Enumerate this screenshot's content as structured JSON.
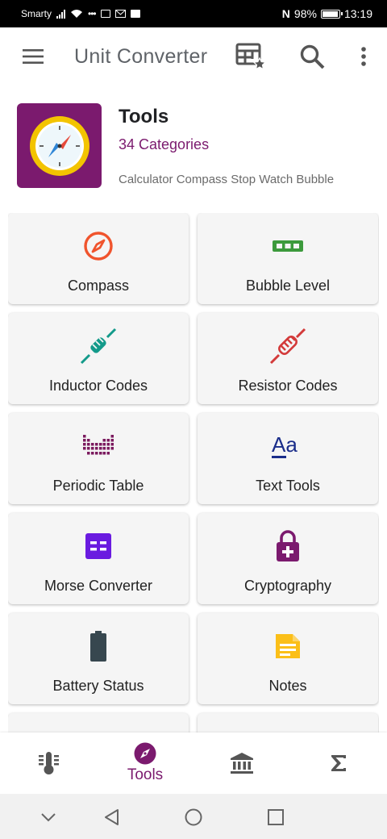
{
  "status_bar": {
    "carrier": "Smarty",
    "battery": "98%",
    "time": "13:19"
  },
  "app_bar": {
    "title": "Unit Converter",
    "icons": [
      "menu-icon",
      "table-favorite-icon",
      "search-icon",
      "more-vert-icon"
    ]
  },
  "header": {
    "title": "Tools",
    "subtitle": "34 Categories",
    "description": "Calculator Compass Stop Watch Bubble",
    "icon": "compass-icon"
  },
  "tools": [
    {
      "label": "Compass",
      "icon": "compass-icon",
      "color": "#f0542d"
    },
    {
      "label": "Bubble Level",
      "icon": "bubble-level-icon",
      "color": "#3c9a3c"
    },
    {
      "label": "Inductor Codes",
      "icon": "inductor-icon",
      "color": "#139a8a"
    },
    {
      "label": "Resistor Codes",
      "icon": "resistor-icon",
      "color": "#d33a3a"
    },
    {
      "label": "Periodic Table",
      "icon": "periodic-table-icon",
      "color": "#7b1a5e"
    },
    {
      "label": "Text Tools",
      "icon": "text-format-icon",
      "color": "#1a2d8a"
    },
    {
      "label": "Morse Converter",
      "icon": "morse-icon",
      "color": "#6a1be0"
    },
    {
      "label": "Cryptography",
      "icon": "lock-icon",
      "color": "#7b1a6e"
    },
    {
      "label": "Battery Status",
      "icon": "battery-icon",
      "color": "#37474f"
    },
    {
      "label": "Notes",
      "icon": "note-icon",
      "color": "#fbbf18"
    }
  ],
  "bottom_nav": {
    "items": [
      {
        "icon": "thermometer-icon",
        "label": ""
      },
      {
        "icon": "compass-icon",
        "label": "Tools",
        "active": true
      },
      {
        "icon": "bank-icon",
        "label": ""
      },
      {
        "icon": "sigma-icon",
        "label": ""
      }
    ],
    "accent": "#7b1a6e"
  },
  "system_nav": [
    "collapse-icon",
    "back-icon",
    "home-icon",
    "recents-icon"
  ]
}
